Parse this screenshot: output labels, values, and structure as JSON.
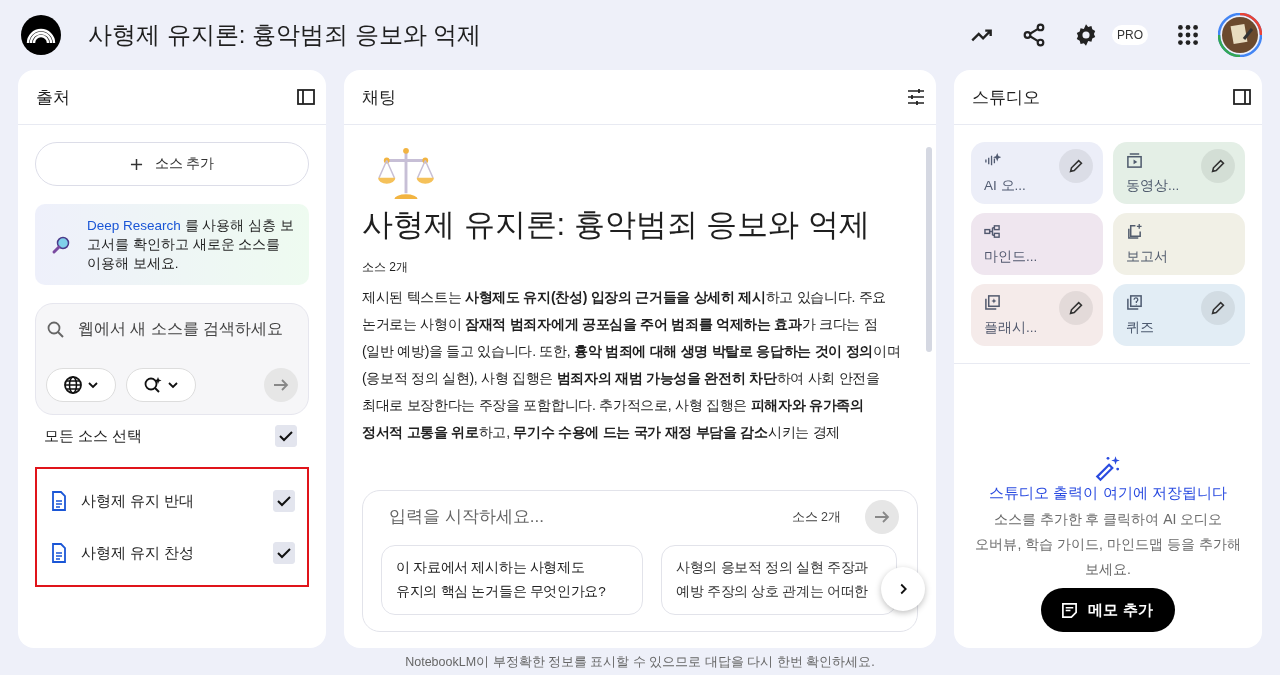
{
  "app": {
    "title": "사형제 유지론: 흉악범죄 응보와 억제",
    "pro_badge": "PRO"
  },
  "sources_panel": {
    "title": "출처",
    "add_button": "소스 추가",
    "deep_research": {
      "link": "Deep Research",
      "text": " 를 사용해 심층 보고서를 확인하고 새로운 소스를 이용해 보세요."
    },
    "search": {
      "placeholder": "웹에서 새 소스를 검색하세요"
    },
    "select_all": {
      "label": "모든 소스 선택",
      "checked": true
    },
    "highlighted": true,
    "sources": [
      {
        "title": "사형제 유지 반대",
        "checked": true
      },
      {
        "title": "사형제 유지 찬성",
        "checked": true
      }
    ]
  },
  "chat_panel": {
    "title": "채팅",
    "heading": "사형제 유지론: 흉악범죄 응보와 억제",
    "source_count": "소스 2개",
    "summary": "제시된 텍스트는 **사형제도 유지(찬성) 입장의 근거들을 상세히 제시**하고 있습니다. 주요 논거로는 사형이 **잠재적 범죄자에게 공포심을 주어 범죄를 억제하는 효과**가 크다는 점(일반 예방)을 들고 있습니다. 또한, **흉악 범죄에 대해 생명 박탈로 응답하는 것이 정의**이며(응보적 정의 실현), 사형 집행은 **범죄자의 재범 가능성을 완전히 차단**하여 사회 안전을 최대로 보장한다는 주장을 포함합니다. 추가적으로, 사형 집행은 **피해자와 유가족의 정서적 고통을 위로**하고, **무기수 수용에 드는 국가 재정 부담을 감소**시키는 경제",
    "input": {
      "placeholder": "입력을 시작하세요...",
      "source_count": "소스 2개"
    },
    "suggestions": [
      {
        "text": "이 자료에서 제시하는 사형제도 유지의 핵심 논거들은 무엇인가요?"
      },
      {
        "text": "사형의 응보적 정의 실현 주장과 예방 주장의 상호 관계는 어떠한"
      }
    ]
  },
  "studio_panel": {
    "title": "스튜디오",
    "tiles": [
      {
        "label": "AI 오...",
        "kind": "audio",
        "color": "#eceef8",
        "editable": true
      },
      {
        "label": "동영상...",
        "kind": "video",
        "color": "#e4efe6",
        "editable": true
      },
      {
        "label": "마인드...",
        "kind": "mindmap",
        "color": "#efe6ef",
        "editable": false
      },
      {
        "label": "보고서",
        "kind": "report",
        "color": "#f1f0e6",
        "editable": false
      },
      {
        "label": "플래시...",
        "kind": "flashcard",
        "color": "#f5ebea",
        "editable": true
      },
      {
        "label": "퀴즈",
        "kind": "quiz",
        "color": "#e2edf5",
        "editable": true
      }
    ],
    "empty_title": "스튜디오 출력이 여기에 저장됩니다",
    "empty_text": "소스를 추가한 후 클릭하여 AI 오디오 오버뷰, 학습 가이드, 마인드맵 등을 추가해 보세요.",
    "note_button": "메모 추가"
  },
  "footer": "NotebookLM이 부정확한 정보를 표시할 수 있으므로 대답을 다시 한번 확인하세요."
}
